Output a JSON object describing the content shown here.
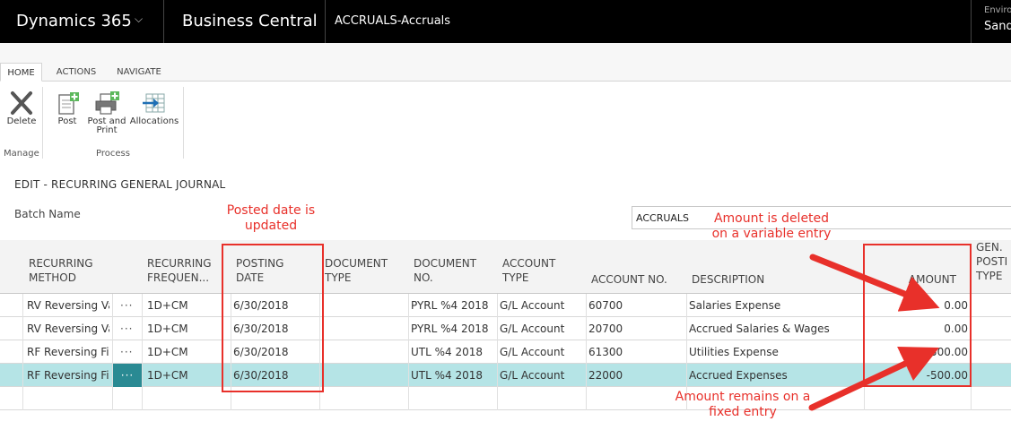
{
  "topbar": {
    "app_name": "Dynamics 365",
    "chevron": "⌵",
    "product": "Business Central",
    "page": "ACCRUALS-Accruals",
    "env_label": "Enviro",
    "env_value": "Sand"
  },
  "ribbon": {
    "tabs": [
      {
        "label": "HOME",
        "active": true
      },
      {
        "label": "ACTIONS",
        "active": false
      },
      {
        "label": "NAVIGATE",
        "active": false
      }
    ],
    "commands": {
      "delete": "Delete",
      "post": "Post",
      "post_print_1": "Post and",
      "post_print_2": "Print",
      "allocations": "Allocations"
    },
    "groups": {
      "manage": "Manage",
      "process": "Process"
    }
  },
  "page": {
    "title": "EDIT - RECURRING GENERAL JOURNAL",
    "batch_label": "Batch Name",
    "batch_value": "ACCRUALS"
  },
  "columns": {
    "recurring_method": [
      "RECURRING",
      "METHOD"
    ],
    "recurring_frequency": [
      "RECURRING",
      "FREQUEN..."
    ],
    "posting_date": [
      "POSTING",
      "DATE"
    ],
    "document_type": [
      "DOCUMENT",
      "TYPE"
    ],
    "document_no": [
      "DOCUMENT",
      "NO."
    ],
    "account_type": [
      "ACCOUNT",
      "TYPE"
    ],
    "account_no": "ACCOUNT NO.",
    "description": "DESCRIPTION",
    "amount": "AMOUNT",
    "gen_posting_type": [
      "GEN.",
      "POSTI",
      "TYPE"
    ]
  },
  "rows": [
    {
      "method": "RV Reversing Va",
      "dots": "···",
      "freq": "1D+CM",
      "date": "6/30/2018",
      "doc_type": "",
      "doc_no": "PYRL %4 2018",
      "acct_type": "G/L Account",
      "acct_no": "60700",
      "desc": "Salaries Expense",
      "amount": "0.00",
      "selected": false
    },
    {
      "method": "RV Reversing Va",
      "dots": "···",
      "freq": "1D+CM",
      "date": "6/30/2018",
      "doc_type": "",
      "doc_no": "PYRL %4 2018",
      "acct_type": "G/L Account",
      "acct_no": "20700",
      "desc": "Accrued Salaries & Wages",
      "amount": "0.00",
      "selected": false
    },
    {
      "method": "RF Reversing Fix",
      "dots": "···",
      "freq": "1D+CM",
      "date": "6/30/2018",
      "doc_type": "",
      "doc_no": "UTL %4 2018",
      "acct_type": "G/L Account",
      "acct_no": "61300",
      "desc": "Utilities Expense",
      "amount": "500.00",
      "selected": false
    },
    {
      "method": "RF Reversing Fix",
      "dots": "···",
      "freq": "1D+CM",
      "date": "6/30/2018",
      "doc_type": "",
      "doc_no": "UTL %4 2018",
      "acct_type": "G/L Account",
      "acct_no": "22000",
      "desc": "Accrued Expenses",
      "amount": "-500.00",
      "selected": true
    },
    {
      "method": "",
      "dots": "",
      "freq": "",
      "date": "",
      "doc_type": "",
      "doc_no": "",
      "acct_type": "",
      "acct_no": "",
      "desc": "",
      "amount": "",
      "selected": false
    }
  ],
  "annotations": {
    "posted_date_1": "Posted date is",
    "posted_date_2": "updated",
    "amount_deleted_1": "Amount is deleted",
    "amount_deleted_2": "on a variable entry",
    "amount_remains_1": "Amount remains on a",
    "amount_remains_2": "fixed entry",
    "color": "#e8302a"
  },
  "colors": {
    "topbar": "#000000",
    "selected_row": "#b5e4e6",
    "accent_icon": "#5cb85c"
  }
}
